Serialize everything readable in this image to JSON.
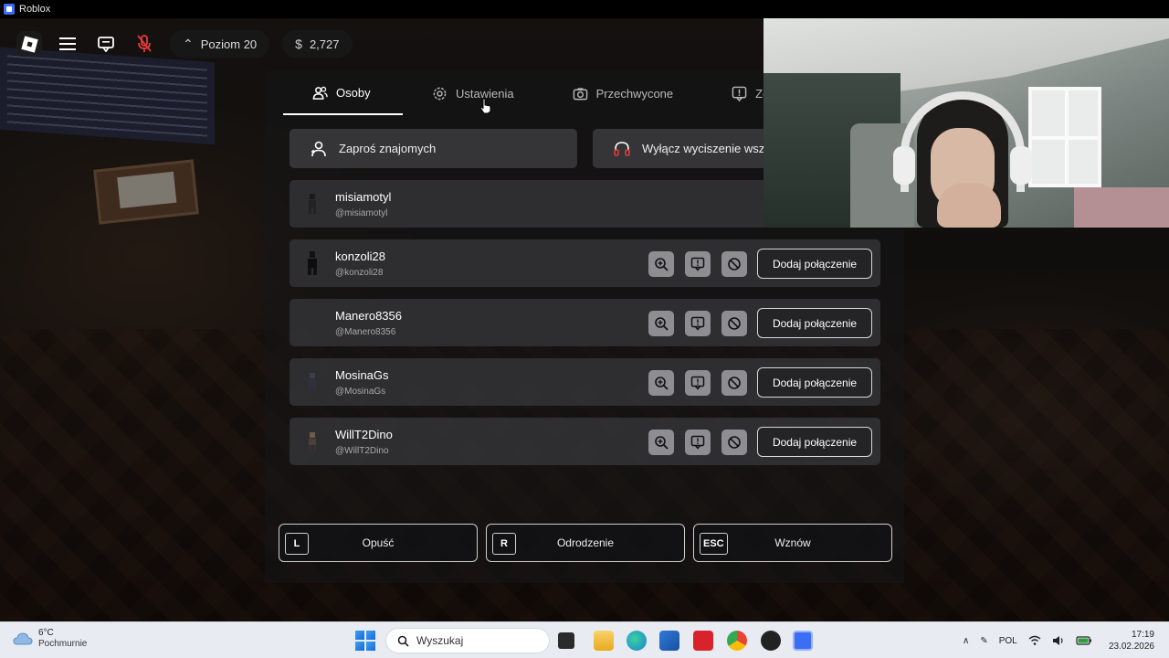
{
  "window": {
    "title": "Roblox"
  },
  "topbar": {
    "level": "Poziom 20",
    "currency_symbol": "$",
    "robux": "2,727"
  },
  "tabs": [
    {
      "label": "Osoby",
      "icon": "people-icon",
      "active": true
    },
    {
      "label": "Ustawienia",
      "icon": "gear-icon",
      "active": false
    },
    {
      "label": "Przechwycone",
      "icon": "camera-icon",
      "active": false
    },
    {
      "label": "Zgłoś",
      "icon": "report-icon",
      "active": false
    }
  ],
  "actions": {
    "invite": "Zaproś znajomych",
    "mute_all": "Wyłącz wyciszenie wszys"
  },
  "self_player": {
    "name": "misiamotyl",
    "handle": "@misiamotyl"
  },
  "players": [
    {
      "name": "konzoli28",
      "handle": "@konzoli28",
      "connect": "Dodaj połączenie"
    },
    {
      "name": "Manero8356",
      "handle": "@Manero8356",
      "connect": "Dodaj połączenie"
    },
    {
      "name": "MosinaGs",
      "handle": "@MosinaGs",
      "connect": "Dodaj połączenie"
    },
    {
      "name": "WillT2Dino",
      "handle": "@WillT2Dino",
      "connect": "Dodaj połączenie"
    }
  ],
  "bottom_buttons": [
    {
      "key": "L",
      "label": "Opuść"
    },
    {
      "key": "R",
      "label": "Odrodzenie"
    },
    {
      "key": "ESC",
      "label": "Wznów"
    }
  ],
  "taskbar": {
    "weather_temp": "6°C",
    "weather_desc": "Pochmurnie",
    "search_placeholder": "Wyszukaj",
    "language": "POL",
    "time": "17:19",
    "date": "23.02.2026"
  },
  "colors": {
    "panel_row": "#323236",
    "accent_white": "#ffffff",
    "taskbar_bg": "#e8ecf2"
  }
}
